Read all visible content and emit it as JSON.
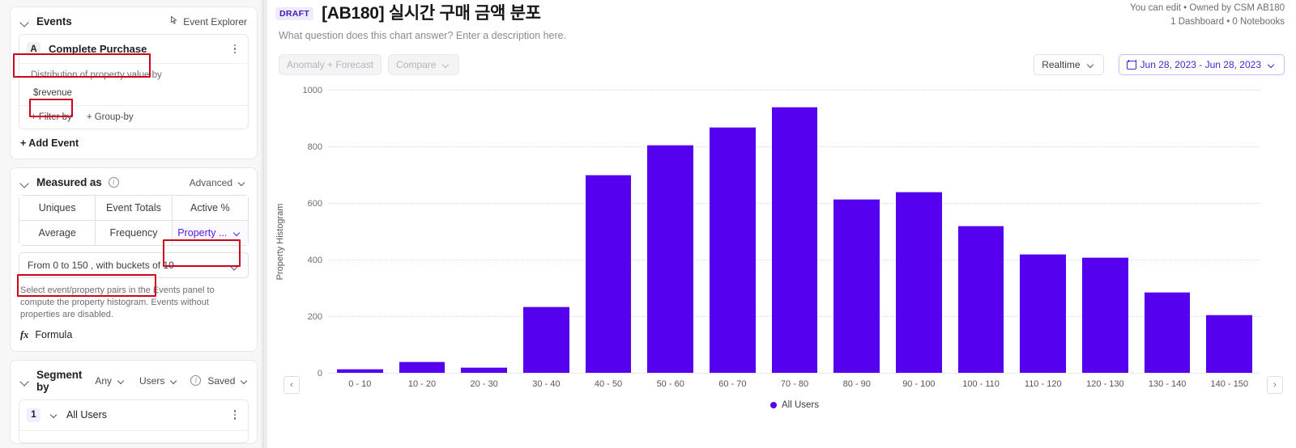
{
  "events_panel": {
    "title": "Events",
    "explorer_label": "Event Explorer",
    "event": {
      "badge": "A",
      "name": "Complete Purchase",
      "prop_label": "Distribution of property value by",
      "prop_value": "$revenue",
      "filter_by": "+ Filter by",
      "group_by": "+ Group-by"
    },
    "add_event": "+ Add Event"
  },
  "measured_panel": {
    "title": "Measured as",
    "advanced_label": "Advanced",
    "options_row1": [
      "Uniques",
      "Event Totals",
      "Active %"
    ],
    "options_row2": [
      "Average",
      "Frequency",
      "Property ..."
    ],
    "selected_option": "Property ...",
    "bucket_select": "From 0 to 150 , with buckets of 10",
    "helper_text": "Select event/property pairs in the Events panel to compute the property histogram. Events without properties are disabled.",
    "formula_label": "Formula",
    "formula_icon": "fx"
  },
  "segment_panel": {
    "title": "Segment by",
    "any_label": "Any",
    "users_label": "Users",
    "saved_label": "Saved",
    "items": [
      {
        "num": "1",
        "label": "All Users"
      }
    ]
  },
  "header": {
    "draft_badge": "DRAFT",
    "title": "[AB180] 실시간 구매 금액 분포",
    "subtitle": "What question does this chart answer? Enter a description here.",
    "meta_line1": "You can edit • Owned by CSM AB180",
    "meta_line2": "1 Dashboard • 0 Notebooks"
  },
  "toolbar": {
    "anomaly_label": "Anomaly + Forecast",
    "compare_label": "Compare",
    "realtime_label": "Realtime",
    "date_range": "Jun 28, 2023 - Jun 28, 2023",
    "prev_arrow": "‹",
    "next_arrow": "›"
  },
  "colors": {
    "bar": "#5500EE",
    "accent": "#4A1FD1",
    "highlight": "#D0021B",
    "draft_bg": "#EFEAFE"
  },
  "chart_data": {
    "type": "bar",
    "title": "[AB180] 실시간 구매 금액 분포",
    "xlabel": "",
    "ylabel": "Property Histogram",
    "ylim": [
      0,
      1000
    ],
    "yticks": [
      0,
      200,
      400,
      600,
      800,
      1000
    ],
    "grid": true,
    "legend_position": "bottom",
    "legend": [
      "All Users"
    ],
    "categories": [
      "0 - 10",
      "10 - 20",
      "20 - 30",
      "30 - 40",
      "40 - 50",
      "50 - 60",
      "60 - 70",
      "70 - 80",
      "80 - 90",
      "90 - 100",
      "100 - 110",
      "110 - 120",
      "120 - 130",
      "130 - 140",
      "140 - 150"
    ],
    "series": [
      {
        "name": "All Users",
        "values": [
          15,
          40,
          20,
          235,
          700,
          805,
          870,
          940,
          615,
          640,
          520,
          420,
          410,
          285,
          205
        ]
      }
    ]
  }
}
